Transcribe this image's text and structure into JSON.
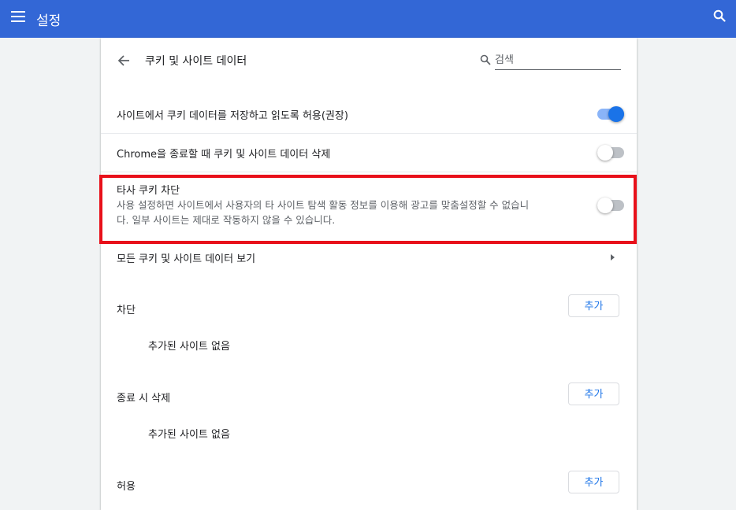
{
  "header": {
    "title": "설정"
  },
  "page": {
    "title": "쿠키 및 사이트 데이터",
    "search_placeholder": "검색"
  },
  "settings": {
    "allow_cookies": {
      "label": "사이트에서 쿠키 데이터를 저장하고 읽도록 허용(권장)",
      "enabled": true
    },
    "clear_on_exit": {
      "label": "Chrome을 종료할 때 쿠키 및 사이트 데이터 삭제",
      "enabled": false
    },
    "block_third_party": {
      "label": "타사 쿠키 차단",
      "description_line1": "사용 설정하면 사이트에서 사용자의 타 사이트 탐색 활동 정보를 이용해 광고를 맞춤설정할 수 없습니",
      "description_line2": "다. 일부 사이트는 제대로 작동하지 않을 수 있습니다.",
      "enabled": false
    },
    "view_all": {
      "label": "모든 쿠키 및 사이트 데이터 보기"
    }
  },
  "sections": [
    {
      "label": "차단",
      "add_label": "추가",
      "empty_text": "추가된 사이트 없음"
    },
    {
      "label": "종료 시 삭제",
      "add_label": "추가",
      "empty_text": "추가된 사이트 없음"
    },
    {
      "label": "허용",
      "add_label": "추가"
    }
  ],
  "colors": {
    "header_bg": "#3367d6",
    "accent": "#1a73e8",
    "highlight_border": "#e8101a"
  }
}
